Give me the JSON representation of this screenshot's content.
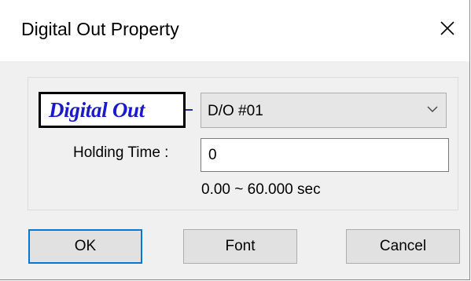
{
  "window": {
    "title": "Digital Out Property",
    "close_glyph": "×"
  },
  "logo": {
    "text": "Digital Out",
    "color": "#1a1acc"
  },
  "combo": {
    "value": "D/O #01"
  },
  "holding": {
    "label": "Holding Time :",
    "value": "0",
    "range": "0.00 ~ 60.000 sec"
  },
  "buttons": {
    "ok": "OK",
    "font": "Font",
    "cancel": "Cancel"
  },
  "colors": {
    "focus_border": "#0078d7",
    "dialog_bg": "#f0f0f0"
  }
}
